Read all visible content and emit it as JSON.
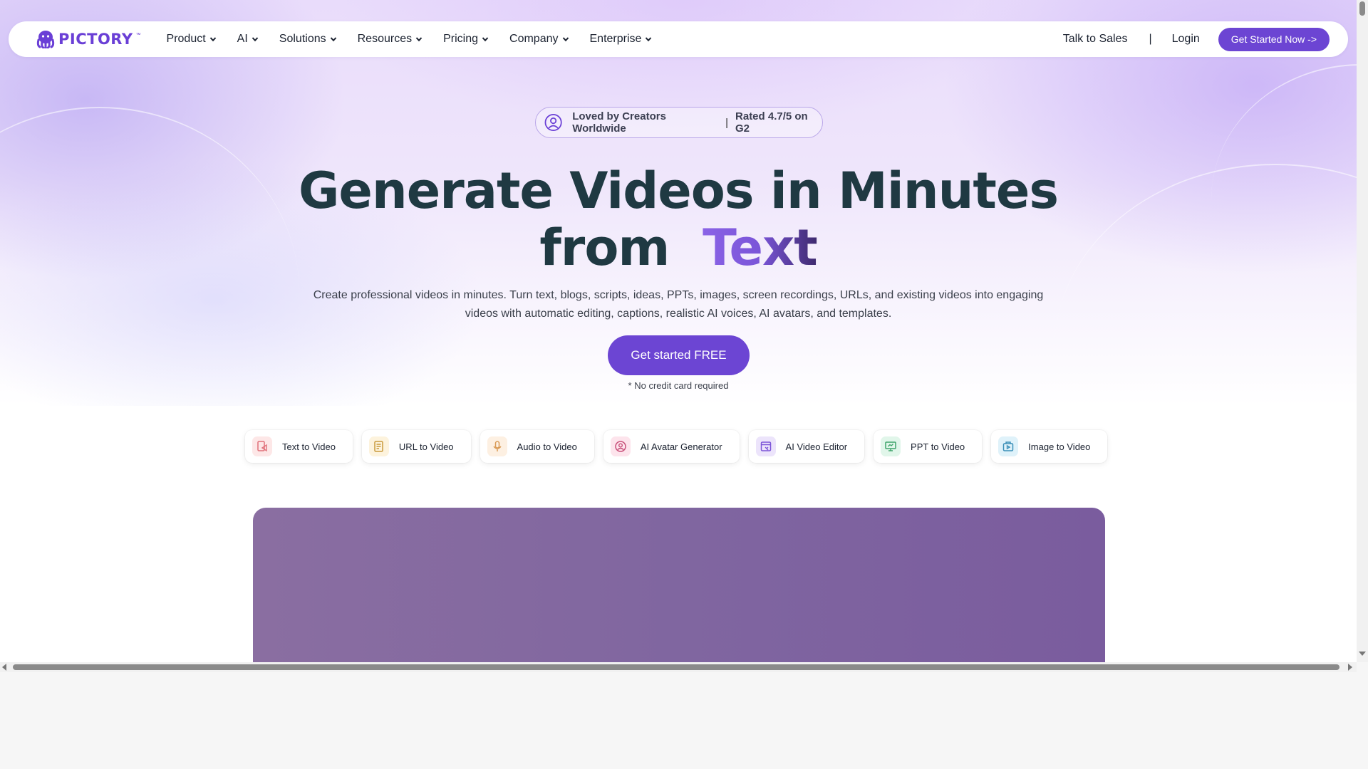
{
  "brand": {
    "name": "PICTORY",
    "trademark": "™",
    "color": "#6a3fd6"
  },
  "nav": {
    "items": [
      {
        "label": "Product"
      },
      {
        "label": "AI"
      },
      {
        "label": "Solutions"
      },
      {
        "label": "Resources"
      },
      {
        "label": "Pricing"
      },
      {
        "label": "Company"
      },
      {
        "label": "Enterprise"
      }
    ],
    "talk_to_sales": "Talk to Sales",
    "separator": "|",
    "login": "Login",
    "get_started_now": "Get Started Now ->"
  },
  "badge": {
    "loved": "Loved by Creators Worldwide",
    "separator": "|",
    "rating": "Rated 4.7/5 on G2",
    "icon": "user-circle-icon"
  },
  "hero": {
    "headline_line1": "Generate Videos in Minutes",
    "headline_from": "from",
    "headline_accent": "Text",
    "subtext": "Create professional videos in minutes. Turn text, blogs, scripts, ideas, PPTs, images, screen recordings, URLs, and existing videos into engaging videos with automatic editing, captions, realistic AI voices, AI avatars, and templates.",
    "cta": "Get started FREE",
    "note": "* No credit card required"
  },
  "features": [
    {
      "label": "Text to Video",
      "icon": "text-to-video-icon",
      "bg": "#fde7e7",
      "fg": "#e0707a"
    },
    {
      "label": "URL to Video",
      "icon": "url-to-video-icon",
      "bg": "#fdf3dd",
      "fg": "#c99a3c"
    },
    {
      "label": "Audio to Video",
      "icon": "microphone-icon",
      "bg": "#fdf0e2",
      "fg": "#d99a55"
    },
    {
      "label": "AI Avatar Generator",
      "icon": "avatar-icon",
      "bg": "#fde4ec",
      "fg": "#c8507a"
    },
    {
      "label": "AI Video Editor",
      "icon": "video-editor-icon",
      "bg": "#ece4fb",
      "fg": "#7c55d8"
    },
    {
      "label": "PPT to Video",
      "icon": "presentation-icon",
      "bg": "#e1f6ea",
      "fg": "#3fa46a"
    },
    {
      "label": "Image to Video",
      "icon": "image-to-video-icon",
      "bg": "#dff2fa",
      "fg": "#3a8fb8"
    }
  ],
  "colors": {
    "accent": "#6c45d3",
    "heading": "#1f3942",
    "video_panel": "#8066a0"
  }
}
